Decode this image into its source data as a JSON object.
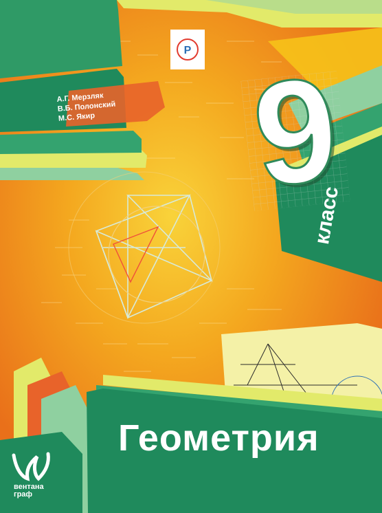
{
  "authors": [
    "А.Г. Мерзляк",
    "В.Б. Полонский",
    "М.С. Якир"
  ],
  "grade": {
    "number": "9",
    "label": "класс"
  },
  "title": "Геометрия",
  "publisher": {
    "line1": "вентана",
    "line2": "граф"
  },
  "badge": {
    "symbol": "Р̃У"
  },
  "colors": {
    "orange": "#ef8a1d",
    "yellow": "#f6c21a",
    "green_dark": "#1f8a5c",
    "green_mid": "#34a36f",
    "green_light": "#8fd0a0",
    "lime": "#e2ea6a",
    "accent_red": "#e23b2e",
    "accent_blue": "#2c6fb5"
  },
  "icons": [
    "triangle-diagram",
    "geometry-construction",
    "publisher-logo",
    "russian-school-badge"
  ]
}
